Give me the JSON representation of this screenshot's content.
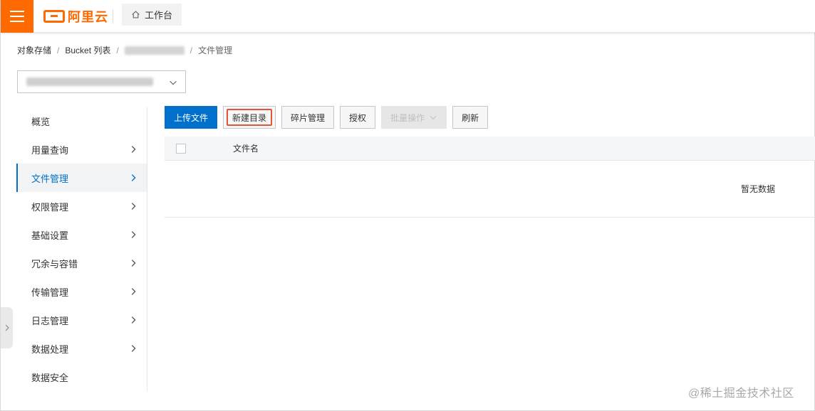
{
  "header": {
    "brand": "阿里云",
    "workbench_label": "工作台",
    "brand_color": "#ff6a00"
  },
  "breadcrumb": {
    "items": [
      "对象存储",
      "Bucket 列表",
      "文件管理"
    ]
  },
  "sidebar": {
    "items": [
      {
        "label": "概览",
        "has_arrow": false
      },
      {
        "label": "用量查询",
        "has_arrow": true
      },
      {
        "label": "文件管理",
        "has_arrow": true,
        "active": true
      },
      {
        "label": "权限管理",
        "has_arrow": true
      },
      {
        "label": "基础设置",
        "has_arrow": true
      },
      {
        "label": "冗余与容错",
        "has_arrow": true
      },
      {
        "label": "传输管理",
        "has_arrow": true
      },
      {
        "label": "日志管理",
        "has_arrow": true
      },
      {
        "label": "数据处理",
        "has_arrow": true
      },
      {
        "label": "数据安全",
        "has_arrow": false
      }
    ],
    "active_color": "#0070cc"
  },
  "toolbar": {
    "upload": "上传文件",
    "new_dir": "新建目录",
    "fragments": "碎片管理",
    "authorize": "授权",
    "batch": "批量操作",
    "refresh": "刷新"
  },
  "table": {
    "column_name": "文件名",
    "empty_text": "暂无数据"
  },
  "watermark": "@稀土掘金技术社区",
  "icons": {
    "menu": "hamburger-icon",
    "home": "home-icon",
    "dropdown": "chevron-down-icon",
    "nav_arrow": "chevron-right-icon",
    "collapse": "chevron-right-icon"
  }
}
